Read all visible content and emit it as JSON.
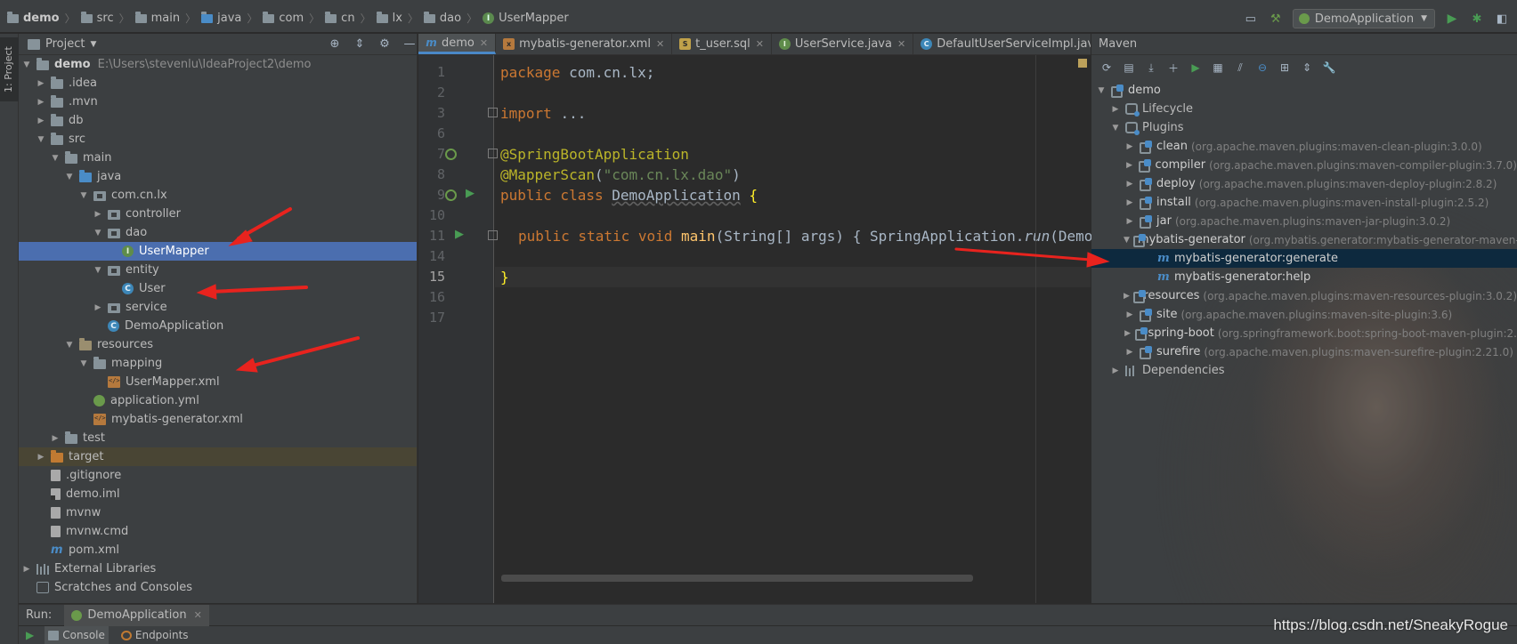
{
  "breadcrumb": [
    "demo",
    "src",
    "main",
    "java",
    "com",
    "cn",
    "lx",
    "dao",
    "UserMapper"
  ],
  "toolbar": {
    "run_config": "DemoApplication"
  },
  "left_strip": {
    "label": "1: Project"
  },
  "project": {
    "title": "Project",
    "tree": [
      {
        "label": "demo",
        "path": "E:\\Users\\stevenlu\\IdeaProject2\\demo"
      },
      {
        "label": ".idea"
      },
      {
        "label": ".mvn"
      },
      {
        "label": "db"
      },
      {
        "label": "src"
      },
      {
        "label": "main"
      },
      {
        "label": "java"
      },
      {
        "label": "com.cn.lx"
      },
      {
        "label": "controller"
      },
      {
        "label": "dao"
      },
      {
        "label": "UserMapper"
      },
      {
        "label": "entity"
      },
      {
        "label": "User"
      },
      {
        "label": "service"
      },
      {
        "label": "DemoApplication"
      },
      {
        "label": "resources"
      },
      {
        "label": "mapping"
      },
      {
        "label": "UserMapper.xml"
      },
      {
        "label": "application.yml"
      },
      {
        "label": "mybatis-generator.xml"
      },
      {
        "label": "test"
      },
      {
        "label": "target"
      },
      {
        "label": ".gitignore"
      },
      {
        "label": "demo.iml"
      },
      {
        "label": "mvnw"
      },
      {
        "label": "mvnw.cmd"
      },
      {
        "label": "pom.xml"
      },
      {
        "label": "External Libraries"
      },
      {
        "label": "Scratches and Consoles"
      }
    ]
  },
  "editor": {
    "tabs": [
      "demo",
      "mybatis-generator.xml",
      "t_user.sql",
      "UserService.java",
      "DefaultUserServiceImpl.java"
    ],
    "line_numbers": [
      "1",
      "2",
      "3",
      "6",
      "7",
      "8",
      "9",
      "10",
      "11",
      "14",
      "15",
      "16",
      "17"
    ],
    "code": {
      "l1_kw": "package ",
      "l1_rest": "com.cn.lx;",
      "l3_kw": "import ",
      "l3_rest": "...",
      "l7": "@SpringBootApplication",
      "l8_ann": "@MapperScan",
      "l8_open": "(",
      "l8_str": "\"com.cn.lx.dao\"",
      "l8_close": ")",
      "l9_kw": "public class ",
      "l9_name": "DemoApplication",
      "l9_brace": " {",
      "l11_kw": "public static void ",
      "l11_fn": "main",
      "l11_params": "(String[] args) { SpringApplication.",
      "l11_run": "run",
      "l11_tail": "(DemoApplication.",
      "l15": "}"
    }
  },
  "maven": {
    "title": "Maven",
    "tree": [
      {
        "label": "demo",
        "desc": ""
      },
      {
        "label": "Lifecycle",
        "desc": ""
      },
      {
        "label": "Plugins",
        "desc": ""
      },
      {
        "label": "clean",
        "desc": "(org.apache.maven.plugins:maven-clean-plugin:3.0.0)"
      },
      {
        "label": "compiler",
        "desc": "(org.apache.maven.plugins:maven-compiler-plugin:3.7.0)"
      },
      {
        "label": "deploy",
        "desc": "(org.apache.maven.plugins:maven-deploy-plugin:2.8.2)"
      },
      {
        "label": "install",
        "desc": "(org.apache.maven.plugins:maven-install-plugin:2.5.2)"
      },
      {
        "label": "jar",
        "desc": "(org.apache.maven.plugins:maven-jar-plugin:3.0.2)"
      },
      {
        "label": "mybatis-generator",
        "desc": "(org.mybatis.generator:mybatis-generator-maven-"
      },
      {
        "label": "mybatis-generator:generate",
        "desc": ""
      },
      {
        "label": "mybatis-generator:help",
        "desc": ""
      },
      {
        "label": "resources",
        "desc": "(org.apache.maven.plugins:maven-resources-plugin:3.0.2)"
      },
      {
        "label": "site",
        "desc": "(org.apache.maven.plugins:maven-site-plugin:3.6)"
      },
      {
        "label": "spring-boot",
        "desc": "(org.springframework.boot:spring-boot-maven-plugin:2."
      },
      {
        "label": "surefire",
        "desc": "(org.apache.maven.plugins:maven-surefire-plugin:2.21.0)"
      },
      {
        "label": "Dependencies",
        "desc": ""
      }
    ]
  },
  "run": {
    "label": "Run:",
    "tab": "DemoApplication",
    "console_tabs": [
      "Console",
      "Endpoints"
    ]
  },
  "watermark": "https://blog.csdn.net/SneakyRogue",
  "colors": {
    "selection": "#4b6eaf",
    "maven_selection": "#0d293e",
    "arrow": "#e8231e",
    "keyword": "#cc7832",
    "annotation": "#bbb529",
    "string": "#6a8759"
  }
}
